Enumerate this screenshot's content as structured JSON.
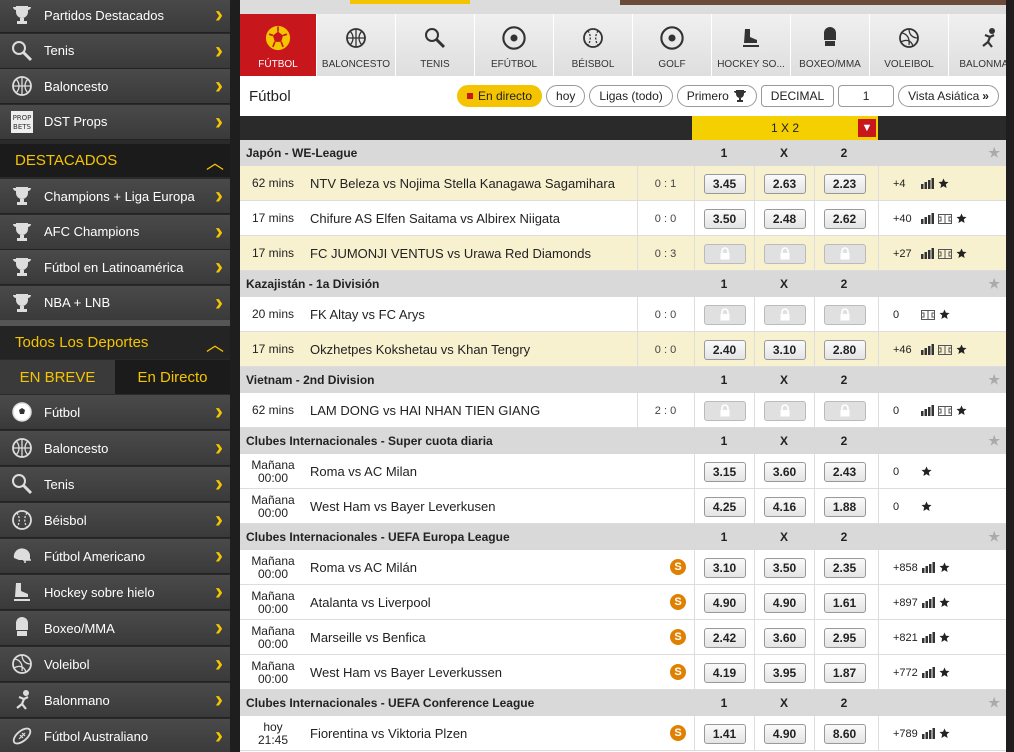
{
  "sidebar": {
    "top_items": [
      {
        "label": "Partidos Destacados",
        "icon": "trophy-icon"
      },
      {
        "label": "Tenis",
        "icon": "tennis-racket-icon"
      },
      {
        "label": "Baloncesto",
        "icon": "basketball-icon"
      },
      {
        "label": "DST Props",
        "icon": "prop-bets-icon"
      }
    ],
    "destacados_label": "DESTACADOS",
    "destacados_items": [
      {
        "label": "Champions + Liga Europa",
        "icon": "trophy-icon"
      },
      {
        "label": "AFC Champions",
        "icon": "trophy-icon"
      },
      {
        "label": "Fútbol en Latinoamérica",
        "icon": "trophy-icon"
      },
      {
        "label": "NBA + LNB",
        "icon": "trophy-icon"
      }
    ],
    "todos_label": "Todos Los Deportes",
    "tabs": [
      "EN BREVE",
      "En Directo"
    ],
    "sport_items": [
      {
        "label": "Fútbol",
        "icon": "soccer-ball-icon"
      },
      {
        "label": "Baloncesto",
        "icon": "basketball-icon"
      },
      {
        "label": "Tenis",
        "icon": "tennis-racket-icon"
      },
      {
        "label": "Béisbol",
        "icon": "baseball-icon"
      },
      {
        "label": "Fútbol Americano",
        "icon": "football-helmet-icon"
      },
      {
        "label": "Hockey sobre hielo",
        "icon": "hockey-skate-icon"
      },
      {
        "label": "Boxeo/MMA",
        "icon": "boxing-glove-icon"
      },
      {
        "label": "Voleibol",
        "icon": "volleyball-icon"
      },
      {
        "label": "Balonmano",
        "icon": "handball-icon"
      },
      {
        "label": "Fútbol Australiano",
        "icon": "rugby-ball-icon"
      }
    ]
  },
  "sports_tabs": [
    "FÚTBOL",
    "BALONCESTO",
    "TENIS",
    "EFÚTBOL",
    "BÉISBOL",
    "GOLF",
    "HOCKEY SO...",
    "BOXEO/MMA",
    "VOLEIBOL",
    "BALONMA..."
  ],
  "filter": {
    "title": "Fútbol",
    "live": "En directo",
    "today": "hoy",
    "leagues": "Ligas (todo)",
    "first": "Primero",
    "decimal": "DECIMAL",
    "one": "1",
    "view": "Vista Asiática"
  },
  "market": {
    "label": "1 X 2"
  },
  "cols": [
    "1",
    "X",
    "2"
  ],
  "leagues": [
    {
      "name": "Japón - WE-League",
      "matches": [
        {
          "time": [
            "62 mins"
          ],
          "teams": "NTV Beleza vs Nojima Stella Kanagawa Sagamihara",
          "score": "0 : 1",
          "odds": [
            "3.45",
            "2.63",
            "2.23"
          ],
          "extra": "+4",
          "hl": true
        },
        {
          "time": [
            "17 mins"
          ],
          "teams": "Chifure AS Elfen Saitama vs Albirex Niigata",
          "score": "0 : 0",
          "odds": [
            "3.50",
            "2.48",
            "2.62"
          ],
          "extra": "+40",
          "hl": false
        },
        {
          "time": [
            "17 mins"
          ],
          "teams": "FC JUMONJI VENTUS vs Urawa Red Diamonds",
          "score": "0 : 3",
          "odds": [
            "",
            "",
            ""
          ],
          "extra": "+27",
          "hl": true
        }
      ]
    },
    {
      "name": "Kazajistán - 1a División",
      "matches": [
        {
          "time": [
            "20 mins"
          ],
          "teams": "FK Altay vs FC Arys",
          "score": "0 : 0",
          "odds": [
            "",
            "",
            ""
          ],
          "extra": "0",
          "hl": false
        },
        {
          "time": [
            "17 mins"
          ],
          "teams": "Okzhetpes Kokshetau vs Khan Tengry",
          "score": "0 : 0",
          "odds": [
            "2.40",
            "3.10",
            "2.80"
          ],
          "extra": "+46",
          "hl": true
        }
      ]
    },
    {
      "name": "Vietnam - 2nd Division",
      "matches": [
        {
          "time": [
            "62 mins"
          ],
          "teams": "LAM DONG vs HAI NHAN TIEN GIANG",
          "score": "2 : 0",
          "odds": [
            "",
            "",
            ""
          ],
          "extra": "0",
          "hl": false
        }
      ]
    },
    {
      "name": "Clubes Internacionales - Super cuota diaria",
      "matches": [
        {
          "time": [
            "Mañana",
            "00:00"
          ],
          "teams": "Roma vs AC Milan",
          "score": "",
          "odds": [
            "3.15",
            "3.60",
            "2.43"
          ],
          "extra": "0",
          "hl": false
        },
        {
          "time": [
            "Mañana",
            "00:00"
          ],
          "teams": "West Ham vs Bayer Leverkusen",
          "score": "",
          "odds": [
            "4.25",
            "4.16",
            "1.88"
          ],
          "extra": "0",
          "hl": false
        }
      ]
    },
    {
      "name": "Clubes Internacionales - UEFA Europa League",
      "matches": [
        {
          "time": [
            "Mañana",
            "00:00"
          ],
          "teams": "Roma vs AC Milán",
          "score": "",
          "odds": [
            "3.10",
            "3.50",
            "2.35"
          ],
          "extra": "+858",
          "hl": false
        },
        {
          "time": [
            "Mañana",
            "00:00"
          ],
          "teams": "Atalanta vs Liverpool",
          "score": "",
          "odds": [
            "4.90",
            "4.90",
            "1.61"
          ],
          "extra": "+897",
          "hl": false
        },
        {
          "time": [
            "Mañana",
            "00:00"
          ],
          "teams": "Marseille vs Benfica",
          "score": "",
          "odds": [
            "2.42",
            "3.60",
            "2.95"
          ],
          "extra": "+821",
          "hl": false
        },
        {
          "time": [
            "Mañana",
            "00:00"
          ],
          "teams": "West Ham vs Bayer Leverkussen",
          "score": "",
          "odds": [
            "4.19",
            "3.95",
            "1.87"
          ],
          "extra": "+772",
          "hl": false
        }
      ]
    },
    {
      "name": "Clubes Internacionales - UEFA Conference League",
      "matches": [
        {
          "time": [
            "hoy",
            "21:45"
          ],
          "teams": "Fiorentina vs Viktoria Plzen",
          "score": "",
          "odds": [
            "1.41",
            "4.90",
            "8.60"
          ],
          "extra": "+789",
          "hl": false
        }
      ]
    }
  ],
  "boost_letter": "S",
  "colors": {
    "accent": "#f5c400",
    "red": "#c8161d"
  }
}
